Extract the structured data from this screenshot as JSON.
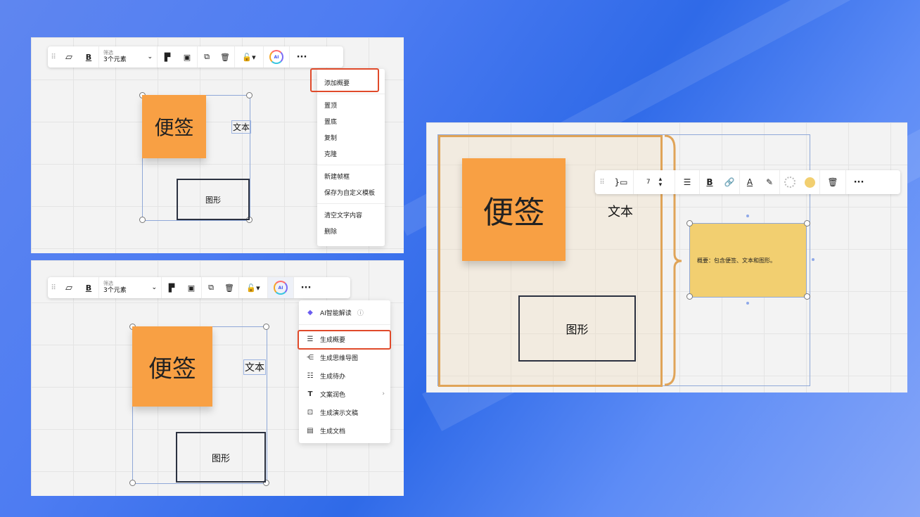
{
  "toolbar": {
    "filter_label": "筛选",
    "filter_value": "3个元素",
    "ai_label": "AI",
    "more_label": "···"
  },
  "canvas": {
    "sticky_text": "便签",
    "text_label": "文本",
    "shape_text": "图形"
  },
  "context_menu": {
    "items": [
      "添加概要",
      "置顶",
      "置底",
      "复制",
      "克隆",
      "新建帧框",
      "保存为自定义模板",
      "清空文字内容",
      "删除"
    ]
  },
  "ai_menu": {
    "header": "AI智能解读",
    "info_icon": "ⓘ",
    "items": [
      "生成概要",
      "生成思维导图",
      "生成待办",
      "文案润色",
      "生成演示文稿",
      "生成文档"
    ]
  },
  "summary_toolbar": {
    "font_size": "7"
  },
  "summary": {
    "text": "概要：包含便签、文本和图形。"
  },
  "colors": {
    "sticky": "#f8a044",
    "summary_fill": "#f2cf70",
    "frame_border": "#e0a458",
    "highlight": "#e04a2a"
  }
}
